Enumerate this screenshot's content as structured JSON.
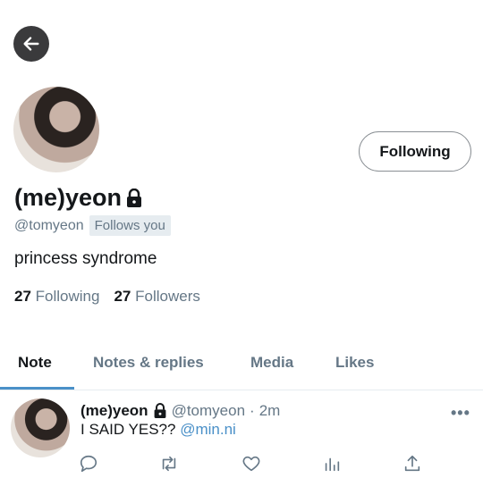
{
  "profile": {
    "display_name": "(me)yeon",
    "handle": "@tomyeon",
    "follows_you": "Follows you",
    "bio": "princess syndrome",
    "following_count": "27",
    "following_label": "Following",
    "followers_count": "27",
    "followers_label": "Followers",
    "follow_button": "Following"
  },
  "tabs": [
    "Note",
    "Notes & replies",
    "Media",
    "Likes"
  ],
  "note": {
    "name": "(me)yeon",
    "handle": "@tomyeon",
    "separator": "·",
    "time": "2m",
    "text": "I SAID YES?? ",
    "mention": "@min.ni",
    "more": "•••"
  },
  "colors": {
    "accent": "#4a90c8",
    "muted": "#657786",
    "text": "#14171a"
  },
  "icons": [
    "back-arrow-icon",
    "lock-icon",
    "reply-icon",
    "renote-icon",
    "like-icon",
    "stats-icon",
    "share-icon"
  ]
}
